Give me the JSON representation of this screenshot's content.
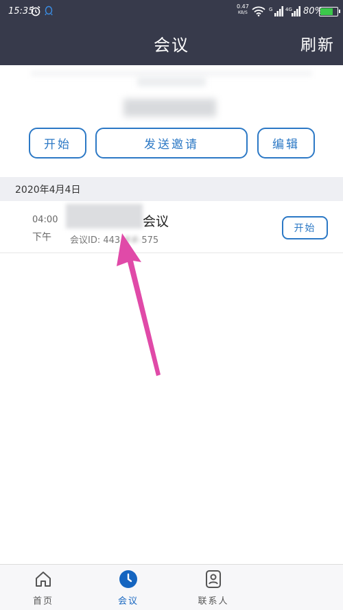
{
  "status_bar": {
    "time": "15:35",
    "net_speed": "0.47",
    "net_unit": "KB/S",
    "battery": "80%",
    "battery_level": 0.8,
    "icons": [
      "alarm-icon",
      "qq-icon",
      "wifi-icon",
      "signal-icon",
      "signal-4g-icon",
      "battery-icon"
    ]
  },
  "header": {
    "title": "会议",
    "refresh_label": "刷新"
  },
  "actions": {
    "start_label": "开始",
    "invite_label": "发送邀请",
    "edit_label": "编辑"
  },
  "date_section": {
    "label": "2020年4月4日"
  },
  "meeting": {
    "time": "04:00",
    "ampm": "下午",
    "title_suffix": "会议",
    "id_label": "会议ID: ",
    "id_prefix": "443",
    "id_hidden": "-##-",
    "id_suffix": "575",
    "start_label": "开始"
  },
  "bottom_nav": {
    "items": [
      {
        "label": "首页",
        "icon": "home-icon"
      },
      {
        "label": "会议",
        "icon": "clock-icon",
        "active": true
      },
      {
        "label": "联系人",
        "icon": "contact-icon"
      }
    ]
  },
  "colors": {
    "header_bg": "#373a4b",
    "accent": "#2b78c5",
    "active_tab": "#1565c0",
    "annotation_arrow": "#e04aa8"
  }
}
